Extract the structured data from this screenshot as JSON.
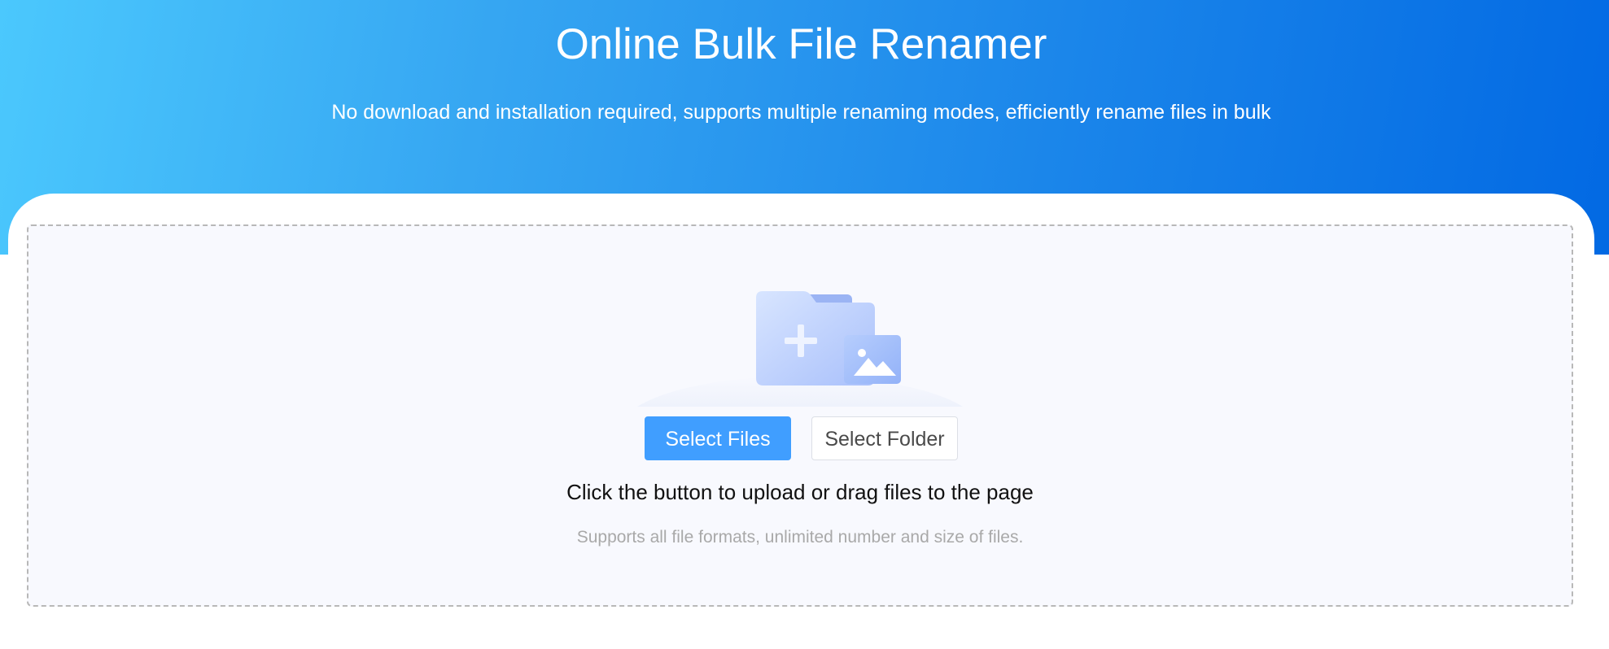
{
  "header": {
    "title": "Online Bulk File Renamer",
    "subtitle": "No download and installation required, supports multiple renaming modes, efficiently rename files in bulk"
  },
  "upload": {
    "illustration_icon": "folder-add-image-icon",
    "select_files_label": "Select Files",
    "select_folder_label": "Select Folder",
    "hint": "Click the button to upload or drag files to the page",
    "sub_hint": "Supports all file formats, unlimited number and size of files."
  },
  "colors": {
    "hero_gradient_start": "#4bc8fd",
    "hero_gradient_end": "#0269e3",
    "primary_button": "#409eff",
    "dropzone_background": "#f8f9fe",
    "dropzone_border": "#b8b8b8",
    "sub_hint_text": "#a9a9a9"
  }
}
